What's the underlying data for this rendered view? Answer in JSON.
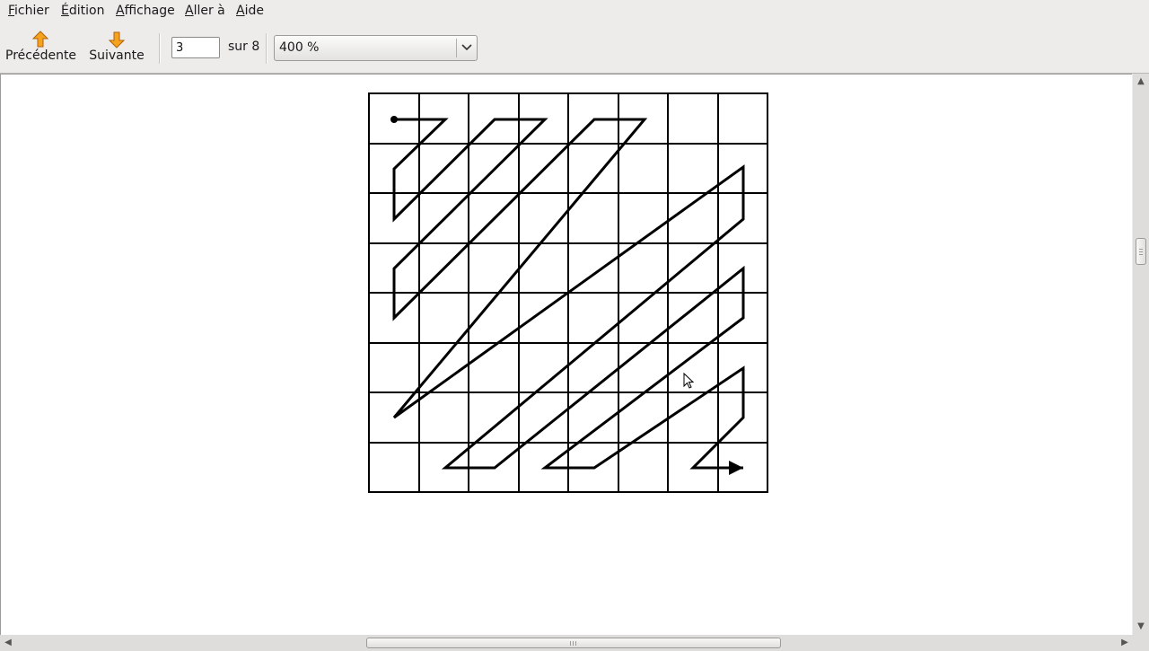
{
  "menu": {
    "items": [
      {
        "mnemonic": "F",
        "rest": "ichier"
      },
      {
        "mnemonic": "É",
        "rest": "dition"
      },
      {
        "mnemonic": "A",
        "rest": "ffichage"
      },
      {
        "mnemonic": "A",
        "rest": "ller à"
      },
      {
        "mnemonic": "A",
        "rest": "ide"
      }
    ]
  },
  "toolbar": {
    "previous_label": "Précédente",
    "next_label": "Suivante",
    "page_value": "3",
    "page_of": "sur 8",
    "zoom_value": "400 %",
    "icon_previous": "arrow-up-icon",
    "icon_next": "arrow-down-icon",
    "accent_color": "#f08a10"
  },
  "document": {
    "content": "zigzag-scan-diagram",
    "grid_rows": 8,
    "grid_cols": 8
  }
}
